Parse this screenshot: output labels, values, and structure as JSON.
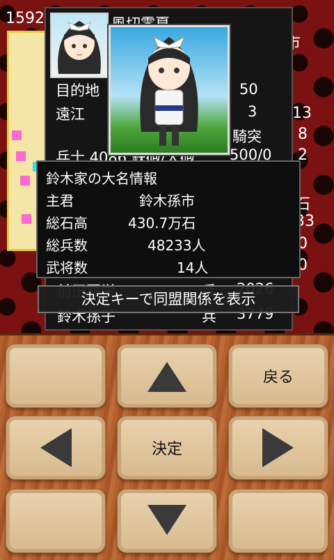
{
  "status": {
    "year": "1592",
    "right_values": [
      "市",
      "13",
      "8",
      "2",
      "石",
      "33",
      "0",
      "0"
    ]
  },
  "officer": {
    "name": "風切零夏",
    "rows": [
      {
        "label": "目的地",
        "value": "50"
      },
      {
        "label": "遠江",
        "value": "3"
      },
      {
        "label": "",
        "value": "騎突"
      },
      {
        "label": "兵士 4086 鉄砲/大砲",
        "value": "500/0"
      }
    ]
  },
  "behind_rows": [
    {
      "name": "前田豆栄",
      "type": "兵",
      "value": "2026"
    },
    {
      "name": "鈴木孫子",
      "type": "兵",
      "value": "3779"
    }
  ],
  "popup": {
    "title": "鈴木家の大名情報",
    "rows": [
      {
        "label": "主君",
        "value": "鈴木孫市"
      },
      {
        "label": "総石高",
        "value": "430.7万石"
      },
      {
        "label": "総兵数",
        "value": "48233人"
      },
      {
        "label": "武将数",
        "value": "14人"
      }
    ]
  },
  "hint": "決定キーで同盟関係を表示",
  "pad": {
    "back_label": "戻る",
    "ok_label": "決定",
    "icons": [
      "up-arrow-icon",
      "left-arrow-icon",
      "right-arrow-icon",
      "down-arrow-icon"
    ]
  }
}
